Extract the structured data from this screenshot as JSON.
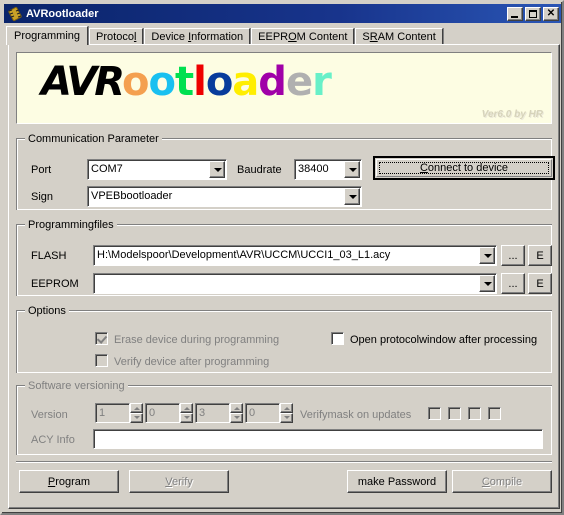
{
  "window": {
    "title": "AVRootloader",
    "icon": "chip-icon",
    "minimize_label": "Minimize",
    "maximize_label": "Maximize",
    "close_label": "Close"
  },
  "tabs": [
    {
      "label": "Programming",
      "accel": "",
      "active": true
    },
    {
      "label": "Protocol",
      "accel": "l",
      "active": false
    },
    {
      "label": "Device Information",
      "accel": "I",
      "active": false
    },
    {
      "label": "EEPROM Content",
      "accel": "O",
      "active": false
    },
    {
      "label": "SRAM Content",
      "accel": "R",
      "active": false
    }
  ],
  "banner": {
    "logo_black": "AVR",
    "logo_letters": [
      {
        "ch": "o",
        "color": "#f4a050"
      },
      {
        "ch": "o",
        "color": "#19c0f0"
      },
      {
        "ch": "t",
        "color": "#00e050"
      },
      {
        "ch": "l",
        "color": "#ee0000"
      },
      {
        "ch": "o",
        "color": "#083c9c"
      },
      {
        "ch": "a",
        "color": "#ffee00"
      },
      {
        "ch": "d",
        "color": "#a000a8"
      },
      {
        "ch": "e",
        "color": "#b0b0b0"
      },
      {
        "ch": "r",
        "color": "#68f0c8"
      }
    ],
    "version_note": "Ver6.0 by HR",
    "background": "#fdfde3"
  },
  "communication": {
    "group_title": "Communication Parameter",
    "port_label": "Port",
    "port_value": "COM7",
    "baudrate_label": "Baudrate",
    "baudrate_value": "38400",
    "sign_label": "Sign",
    "sign_value": "VPEBbootloader",
    "connect_button": "Connect to device",
    "connect_accel": "C"
  },
  "programmingfiles": {
    "group_title": "Programmingfiles",
    "flash_label": "FLASH",
    "flash_value": "H:\\Modelspoor\\Development\\AVR\\UCCM\\UCCI1_03_L1.acy",
    "eeprom_label": "EEPROM",
    "eeprom_value": "",
    "browse_label": "...",
    "edit_label": "E"
  },
  "options": {
    "group_title": "Options",
    "erase_label": "Erase device during programming",
    "erase_checked": true,
    "erase_enabled": false,
    "verify_label": "Verify device after programming",
    "verify_checked": false,
    "verify_enabled": false,
    "protocolwindow_label": "Open protocolwindow after processing",
    "protocolwindow_checked": false,
    "protocolwindow_enabled": true
  },
  "versioning": {
    "group_title": "Software versioning",
    "version_label": "Version",
    "version_parts": [
      "1",
      "0",
      "3",
      "0"
    ],
    "verifymask_label": "Verifymask on updates",
    "verifymask_boxes": [
      false,
      false,
      false,
      false
    ],
    "acy_label": "ACY Info",
    "acy_value": ""
  },
  "actions": {
    "program_label": "Program",
    "program_accel": "P",
    "verify_label": "Verify",
    "verify_accel": "V",
    "make_password_label": "make Password",
    "compile_label": "Compile",
    "compile_accel": "C"
  },
  "colors": {
    "face": "#d4d0c8",
    "titlebar": "#0a246a",
    "banner": "#fdfde3",
    "disabled_text": "#808080"
  }
}
